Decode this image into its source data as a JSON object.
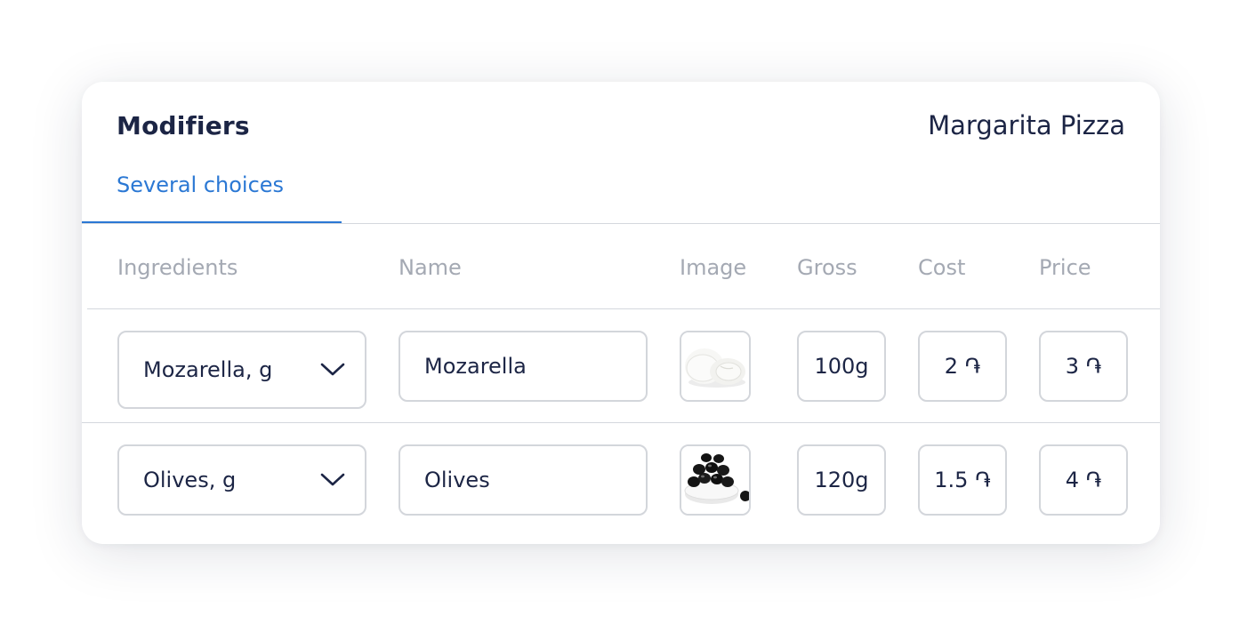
{
  "header": {
    "title": "Modifiers",
    "product": "Margarita Pizza"
  },
  "tabs": [
    {
      "label": "Several choices",
      "active": true
    }
  ],
  "columns": {
    "ingredients": "Ingredients",
    "name": "Name",
    "image": "Image",
    "gross": "Gross",
    "cost": "Cost",
    "price": "Price"
  },
  "rows": [
    {
      "ingredient": "Mozarella, g",
      "name": "Mozarella",
      "image_icon": "mozzarella-image",
      "gross": "100g",
      "cost": "2 ֏",
      "price": "3 ֏"
    },
    {
      "ingredient": "Olives, g",
      "name": "Olives",
      "image_icon": "olives-image",
      "gross": "120g",
      "cost": "1.5 ֏",
      "price": "4 ֏"
    }
  ],
  "colors": {
    "accent": "#2b78d4",
    "text": "#1c2545",
    "muted": "#a4a9b3",
    "border": "#d3d6db"
  }
}
